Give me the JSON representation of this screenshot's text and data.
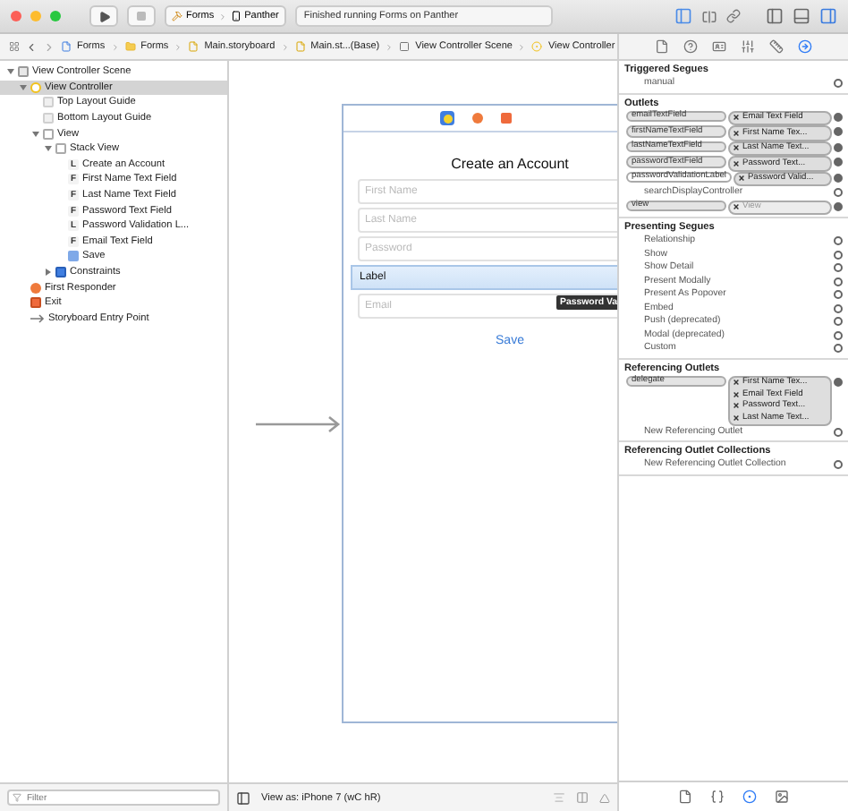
{
  "toolbar": {
    "scheme": "Forms",
    "device": "Panther",
    "status": "Finished running Forms on Panther"
  },
  "breadcrumbs": [
    {
      "kind": "project",
      "label": "Forms"
    },
    {
      "kind": "folder",
      "label": "Forms"
    },
    {
      "kind": "storyboard",
      "label": "Main.storyboard"
    },
    {
      "kind": "storyboard",
      "label": "Main.st...(Base)"
    },
    {
      "kind": "scene",
      "label": "View Controller Scene"
    },
    {
      "kind": "controller",
      "label": "View Controller"
    }
  ],
  "navigator": {
    "tree": [
      {
        "kind": "scene",
        "label": "View Controller Scene",
        "expanded": true,
        "selected": false,
        "children": [
          {
            "kind": "controller",
            "label": "View Controller",
            "expanded": true,
            "selected": true,
            "children": [
              {
                "kind": "guide",
                "label": "Top Layout Guide",
                "selected": false
              },
              {
                "kind": "guide",
                "label": "Bottom Layout Guide",
                "selected": false
              },
              {
                "kind": "view",
                "label": "View",
                "expanded": true,
                "selected": false,
                "children": [
                  {
                    "kind": "view",
                    "label": "Stack View",
                    "expanded": true,
                    "selected": false,
                    "children": [
                      {
                        "kind": "letter",
                        "badge": "L",
                        "label": "Create an Account",
                        "selected": false
                      },
                      {
                        "kind": "letter",
                        "badge": "F",
                        "label": "First Name Text Field",
                        "selected": false
                      },
                      {
                        "kind": "letter",
                        "badge": "F",
                        "label": "Last Name Text Field",
                        "selected": false
                      },
                      {
                        "kind": "letter",
                        "badge": "F",
                        "label": "Password Text Field",
                        "selected": false
                      },
                      {
                        "kind": "letter",
                        "badge": "L",
                        "label": "Password Validation L...",
                        "selected": false
                      },
                      {
                        "kind": "letter",
                        "badge": "F",
                        "label": "Email Text Field",
                        "selected": false
                      },
                      {
                        "kind": "button",
                        "label": "Save",
                        "selected": false
                      }
                    ]
                  },
                  {
                    "kind": "constraints",
                    "label": "Constraints",
                    "expanded": false,
                    "selected": false
                  }
                ]
              }
            ]
          },
          {
            "kind": "responder",
            "label": "First Responder",
            "selected": false
          },
          {
            "kind": "exit",
            "label": "Exit",
            "selected": false
          },
          {
            "kind": "entry",
            "label": "Storyboard Entry Point",
            "selected": false
          }
        ]
      }
    ],
    "filter": {
      "placeholder": "Filter"
    }
  },
  "canvas": {
    "title": "Create an Account",
    "rows": [
      {
        "kind": "field",
        "placeholder": "First Name",
        "selected": false
      },
      {
        "kind": "field",
        "placeholder": "Last Name",
        "selected": false
      },
      {
        "kind": "field",
        "placeholder": "Password",
        "selected": false
      },
      {
        "kind": "label",
        "text": "Label",
        "selected": true,
        "tooltip": "Password Va"
      },
      {
        "kind": "field",
        "placeholder": "Email",
        "selected": false
      }
    ],
    "button": "Save",
    "view_as": "View as: iPhone 7 (wC hR)"
  },
  "inspector_tabs": [
    {
      "kind": "file",
      "selected": false
    },
    {
      "kind": "help",
      "selected": false
    },
    {
      "kind": "identity",
      "selected": false
    },
    {
      "kind": "attributes",
      "selected": false
    },
    {
      "kind": "size",
      "selected": false
    },
    {
      "kind": "connections",
      "selected": true
    }
  ],
  "connections": [
    {
      "title": "Triggered Segues",
      "items": [
        {
          "name": "manual",
          "connected": false
        }
      ]
    },
    {
      "title": "Outlets",
      "items": [
        {
          "name": "emailTextField",
          "connected": true,
          "target": "Email Text Field"
        },
        {
          "name": "firstNameTextField",
          "connected": true,
          "target": "First Name Tex..."
        },
        {
          "name": "lastNameTextField",
          "connected": true,
          "target": "Last Name Text..."
        },
        {
          "name": "passwordTextField",
          "connected": true,
          "target": "Password Text..."
        },
        {
          "name": "passwordValidationLabel",
          "connected": true,
          "target": "Password Valid...",
          "highlighted": true
        },
        {
          "name": "searchDisplayController",
          "connected": false
        },
        {
          "name": "view",
          "connected": true,
          "target": "View",
          "dimmed": true
        }
      ]
    },
    {
      "title": "Presenting Segues",
      "items": [
        {
          "name": "Relationship",
          "connected": false
        },
        {
          "name": "Show",
          "connected": false
        },
        {
          "name": "Show Detail",
          "connected": false
        },
        {
          "name": "Present Modally",
          "connected": false
        },
        {
          "name": "Present As Popover",
          "connected": false
        },
        {
          "name": "Embed",
          "connected": false
        },
        {
          "name": "Push (deprecated)",
          "connected": false
        },
        {
          "name": "Modal (deprecated)",
          "connected": false
        },
        {
          "name": "Custom",
          "connected": false
        }
      ]
    },
    {
      "title": "Referencing Outlets",
      "items": [
        {
          "name": "delegate",
          "connected": true,
          "targets": [
            "First Name Tex...",
            "Email Text Field",
            "Password Text...",
            "Last Name Text..."
          ]
        },
        {
          "name": "New Referencing Outlet",
          "connected": false
        }
      ]
    },
    {
      "title": "Referencing Outlet Collections",
      "items": [
        {
          "name": "New Referencing Outlet Collection",
          "connected": false
        }
      ]
    }
  ],
  "library_tabs": [
    {
      "kind": "file",
      "selected": false
    },
    {
      "kind": "code",
      "selected": false
    },
    {
      "kind": "object",
      "selected": true
    },
    {
      "kind": "media",
      "selected": false
    }
  ]
}
